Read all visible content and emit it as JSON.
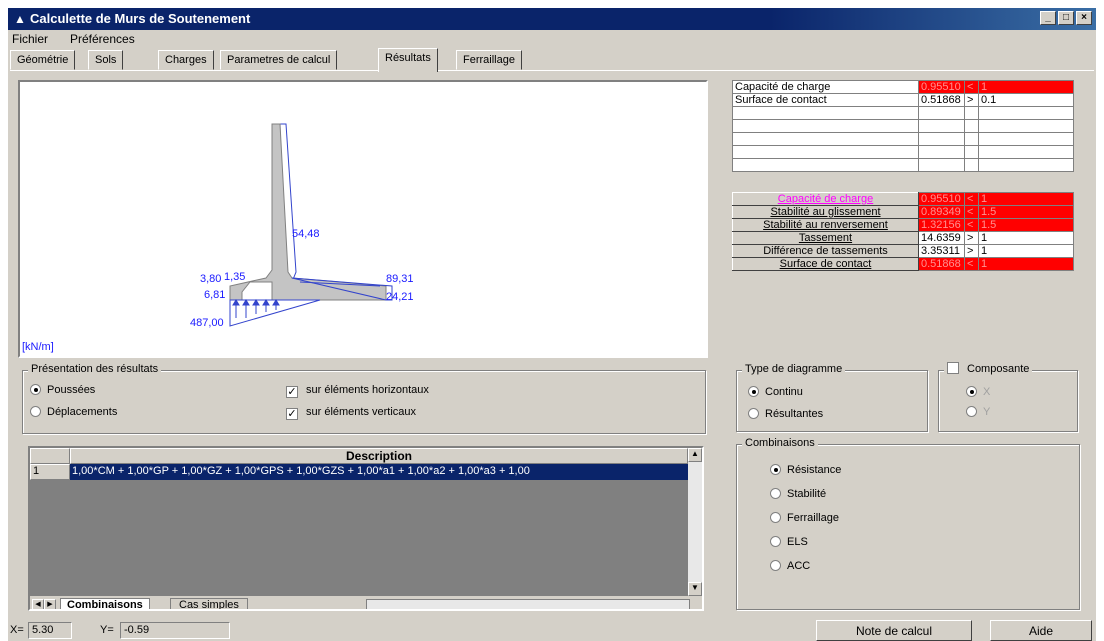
{
  "window": {
    "title": "Calculette de Murs de Soutenement"
  },
  "menu": {
    "items": [
      "Fichier",
      "Préférences"
    ]
  },
  "tabs": [
    "Géométrie",
    "Sols",
    "Charges",
    "Parametres de calcul",
    "Résultats",
    "Ferraillage"
  ],
  "drawing": {
    "labels": [
      "54,48",
      "3,80",
      "1,35",
      "89,31",
      "6,81",
      "24,21",
      "487,00"
    ],
    "unit": "[kN/m]"
  },
  "summary_table": [
    {
      "label": "Capacité de charge",
      "value": "0.95510",
      "op": "<",
      "limit": "1"
    },
    {
      "label": "Surface de contact",
      "value": "0.51868",
      "op": ">",
      "limit": "0.1"
    }
  ],
  "checks": [
    {
      "label": "Capacité de charge",
      "value": "0.95510",
      "op": "<",
      "limit": "1",
      "status": "fail"
    },
    {
      "label": "Stabilité au glissement",
      "value": "0.89349",
      "op": "<",
      "limit": "1.5",
      "status": "fail"
    },
    {
      "label": "Stabilité au renversement",
      "value": "1.32156",
      "op": "<",
      "limit": "1.5",
      "status": "fail"
    },
    {
      "label": "Tassement",
      "value": "14.6359",
      "op": ">",
      "limit": "1",
      "status": "ok"
    },
    {
      "label": "Différence de tassements",
      "value": "3.35311",
      "op": ">",
      "limit": "1",
      "status": "ok"
    },
    {
      "label": "Surface de contact",
      "value": "0.51868",
      "op": "<",
      "limit": "1",
      "status": "fail"
    }
  ],
  "presentation": {
    "title": "Présentation des résultats",
    "options": [
      "Poussées",
      "Déplacements"
    ],
    "selected": "Poussées",
    "checks": [
      "sur éléments horizontaux",
      "sur éléments verticaux"
    ]
  },
  "diagram_type": {
    "title": "Type de diagramme",
    "options": [
      "Continu",
      "Résultantes"
    ],
    "selected": "Continu"
  },
  "composante": {
    "label": "Composante",
    "options": [
      "X",
      "Y"
    ]
  },
  "combinaisons": {
    "title": "Combinaisons",
    "options": [
      "Résistance",
      "Stabilité",
      "Ferraillage",
      "ELS",
      "ACC"
    ],
    "selected": "Résistance"
  },
  "description_grid": {
    "header": "Description",
    "rows": [
      {
        "index": "1",
        "text": "1,00*CM + 1,00*GP + 1,00*GZ + 1,00*GPS + 1,00*GZS + 1,00*a1 + 1,00*a2 + 1,00*a3 + 1,00"
      }
    ],
    "tabs": [
      "Combinaisons",
      "Cas simples"
    ]
  },
  "status": {
    "x_label": "X=",
    "x_value": "5.30",
    "y_label": "Y=",
    "y_value": "-0.59"
  },
  "buttons": {
    "note": "Note de calcul",
    "help": "Aide"
  }
}
